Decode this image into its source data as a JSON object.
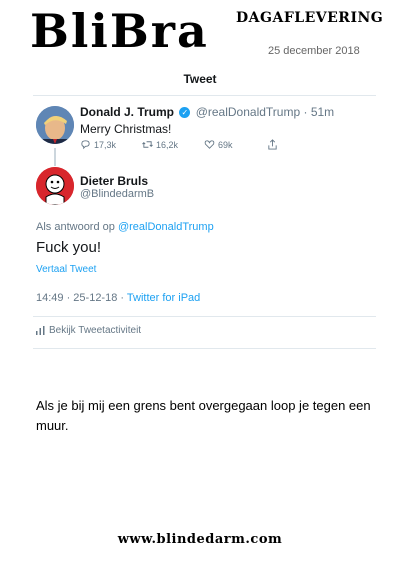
{
  "masthead": {
    "logo": "BliBra",
    "edition": "DAGAFLEVERING",
    "date": "25 december 2018"
  },
  "tweet_view": {
    "header": "Tweet",
    "original": {
      "name": "Donald J. Trump",
      "handle": "@realDonaldTrump",
      "age": "· 51m",
      "text": "Merry Christmas!",
      "replies": "17,3k",
      "retweets": "16,2k",
      "likes": "69k",
      "avatar_icon": "trump-avatar"
    },
    "reply": {
      "name": "Dieter Bruls",
      "handle": "@BlindedarmB",
      "avatar_icon": "cartoon-avatar",
      "replying_prefix": "Als antwoord op",
      "replying_to": "@realDonaldTrump",
      "text": "Fuck you!",
      "translate": "Vertaal Tweet",
      "timestamp": "14:49 · 25-12-18 ·",
      "source": "Twitter for iPad",
      "activity": "Bekijk Tweetactiviteit"
    },
    "colors": {
      "accent": "#1da1f2",
      "muted": "#657786"
    }
  },
  "caption": "Als je bij mij een grens bent overgegaan loop je tegen een muur.",
  "footer": "www.blindedarm.com"
}
